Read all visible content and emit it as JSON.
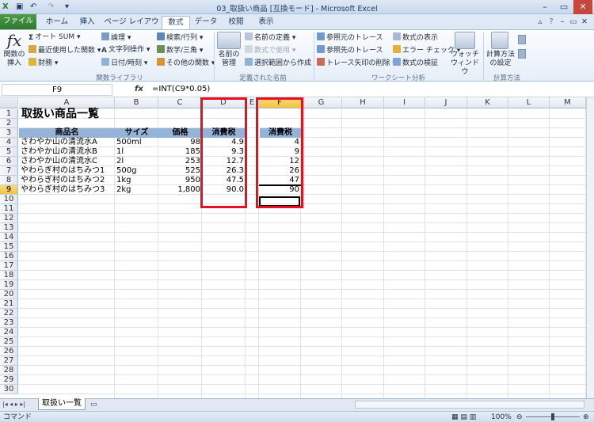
{
  "window": {
    "title": "03_取扱い商品 [互換モード] - Microsoft Excel"
  },
  "tabs": {
    "file": "ファイル",
    "home": "ホーム",
    "insert": "挿入",
    "layout": "ページ レイアウト",
    "formulas": "数式",
    "data": "データ",
    "review": "校閲",
    "view": "表示"
  },
  "ribbon": {
    "insert_func": "関数の挿入",
    "autosum": "オート SUM",
    "recent": "最近使用した関数",
    "financial": "財務",
    "logical": "論理",
    "text": "文字列操作",
    "datetime": "日付/時刻",
    "lookup": "検索/行列",
    "math": "数学/三角",
    "more": "その他の関数",
    "group_lib": "関数ライブラリ",
    "name_mgr": "名前の管理",
    "define_name": "名前の定義",
    "use_in_formula": "数式で使用",
    "create_sel": "選択範囲から作成",
    "group_names": "定義された名前",
    "trace_prec": "参照元のトレース",
    "trace_dep": "参照先のトレース",
    "remove_arrows": "トレース矢印の削除",
    "show_formulas": "数式の表示",
    "error_check": "エラー チェック",
    "evaluate": "数式の検証",
    "watch": "ウォッチ ウィンドウ",
    "group_audit": "ワークシート分析",
    "calc_opts": "計算方法の設定",
    "group_calc": "計算方法"
  },
  "formula_bar": {
    "name_box": "F9",
    "fx": "fx",
    "formula": "=INT(C9*0.05)"
  },
  "columns": [
    "A",
    "B",
    "C",
    "D",
    "E",
    "F",
    "G",
    "H",
    "I",
    "J",
    "K",
    "L",
    "M"
  ],
  "rows": [
    "1",
    "2",
    "3",
    "4",
    "5",
    "6",
    "7",
    "8",
    "9",
    "10",
    "11",
    "12",
    "13",
    "14",
    "15",
    "16",
    "17",
    "18",
    "19",
    "20",
    "21",
    "22",
    "23",
    "24",
    "25",
    "26",
    "27",
    "28",
    "29",
    "30"
  ],
  "sheet": {
    "title": "取扱い商品一覧",
    "headers": {
      "name": "商品名",
      "size": "サイズ",
      "price": "価格",
      "tax_d": "消費税",
      "tax_f": "消費税"
    },
    "items": [
      {
        "name": "さわやか山の清流水A",
        "size": "500ml",
        "price": "98",
        "tax_d": "4.9",
        "tax_f": "4"
      },
      {
        "name": "さわやか山の清流水B",
        "size": "1l",
        "price": "185",
        "tax_d": "9.3",
        "tax_f": "9"
      },
      {
        "name": "さわやか山の清流水C",
        "size": "2l",
        "price": "253",
        "tax_d": "12.7",
        "tax_f": "12"
      },
      {
        "name": "やわらぎ村のはちみつ1",
        "size": "500g",
        "price": "525",
        "tax_d": "26.3",
        "tax_f": "26"
      },
      {
        "name": "やわらぎ村のはちみつ2",
        "size": "1kg",
        "price": "950",
        "tax_d": "47.5",
        "tax_f": "47"
      },
      {
        "name": "やわらぎ村のはちみつ3",
        "size": "2kg",
        "price": "1,800",
        "tax_d": "90.0",
        "tax_f": "90"
      }
    ]
  },
  "sheet_tab": "取扱い一覧",
  "status": {
    "mode": "コマンド",
    "zoom": "100%"
  }
}
